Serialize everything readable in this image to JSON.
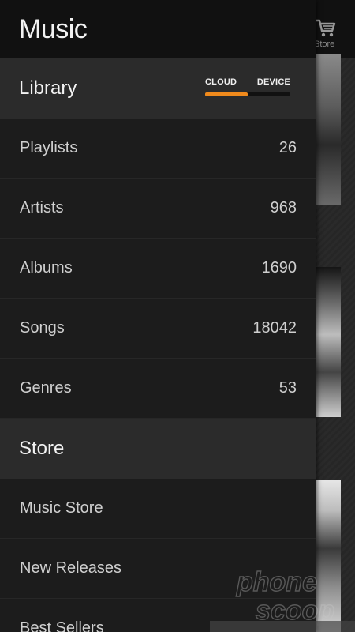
{
  "app": {
    "title": "Music"
  },
  "background": {
    "store_label": "Store"
  },
  "library": {
    "title": "Library",
    "toggle": {
      "options": [
        "CLOUD",
        "DEVICE"
      ],
      "selected": "CLOUD",
      "accent": "#f08a1c"
    },
    "items": [
      {
        "label": "Playlists",
        "count": "26"
      },
      {
        "label": "Artists",
        "count": "968"
      },
      {
        "label": "Albums",
        "count": "1690"
      },
      {
        "label": "Songs",
        "count": "18042"
      },
      {
        "label": "Genres",
        "count": "53"
      }
    ]
  },
  "store": {
    "title": "Store",
    "items": [
      {
        "label": "Music Store"
      },
      {
        "label": "New Releases"
      },
      {
        "label": "Best Sellers"
      }
    ]
  },
  "watermark": {
    "line1": "phone",
    "line2": "scoop"
  }
}
